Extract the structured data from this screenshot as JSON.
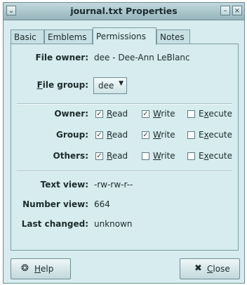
{
  "window": {
    "title": "journal.txt Properties",
    "menu_glyph": "⌄",
    "minimize_glyph": "–",
    "close_glyph": "×"
  },
  "tabs": [
    {
      "label": "Basic",
      "active": false
    },
    {
      "label": "Emblems",
      "active": false
    },
    {
      "label": "Permissions",
      "active": true
    },
    {
      "label": "Notes",
      "active": false
    }
  ],
  "permissions": {
    "file_owner_label": "File owner:",
    "file_owner_value": "dee - Dee-Ann LeBlanc",
    "file_group_label": "File group:",
    "file_group_value": "dee",
    "rows": [
      {
        "label": "Owner:",
        "read": true,
        "write": true,
        "execute": false
      },
      {
        "label": "Group:",
        "read": true,
        "write": true,
        "execute": false
      },
      {
        "label": "Others:",
        "read": true,
        "write": false,
        "execute": false
      }
    ],
    "read_label": "Read",
    "write_label": "Write",
    "execute_label": "Execute",
    "text_view_label": "Text view:",
    "text_view_value": "-rw-rw-r--",
    "number_view_label": "Number view:",
    "number_view_value": "664",
    "last_changed_label": "Last changed:",
    "last_changed_value": "unknown"
  },
  "buttons": {
    "help_label": "Help",
    "close_label": "Close"
  },
  "icons": {
    "help": "help-icon",
    "close": "close-x-icon",
    "check_mark": "✓"
  }
}
